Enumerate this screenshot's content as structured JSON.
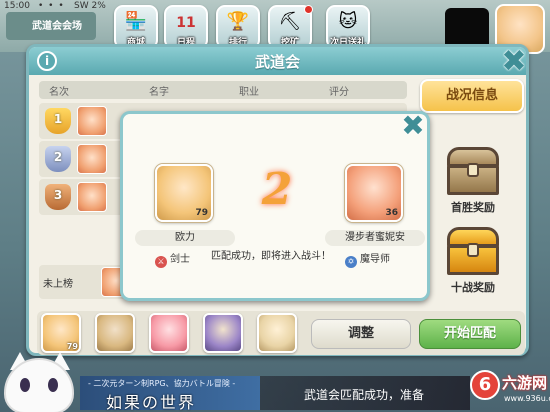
{
  "status_bar": {
    "time": "15:00",
    "dots": "• • •",
    "right": "SW 2%"
  },
  "top_banner": {
    "label": "武道会会场"
  },
  "top_icons": [
    {
      "label": "商城",
      "icon": "shop-icon",
      "glyph": "🏪"
    },
    {
      "label": "日程",
      "icon": "calendar-icon",
      "glyph": "📅",
      "value": "11"
    },
    {
      "label": "排行",
      "icon": "trophy-icon",
      "glyph": "🏆"
    },
    {
      "label": "挖矿",
      "icon": "mining-icon",
      "glyph": "⛏"
    },
    {
      "label": "次日送礼",
      "icon": "gift-icon",
      "glyph": "🐱"
    }
  ],
  "main_panel": {
    "title": "武道会",
    "columns": [
      "名次",
      "名字",
      "职业",
      "评分"
    ],
    "ranks": [
      {
        "rank": "1"
      },
      {
        "rank": "2"
      },
      {
        "rank": "3"
      }
    ],
    "unranked_label": "未上榜",
    "battle_info_label": "战况信息",
    "first_win_label": "首胜奖励",
    "ten_battle_label": "十战奖励",
    "team": [
      {
        "level": "79"
      },
      {
        "level": ""
      },
      {
        "level": ""
      },
      {
        "level": ""
      },
      {
        "level": ""
      }
    ],
    "adjust_label": "调整",
    "start_match_label": "开始匹配"
  },
  "match_popup": {
    "countdown": "2",
    "message": "匹配成功，即将进入战斗！",
    "player": {
      "name": "欧力",
      "class": "剑士",
      "level": "79"
    },
    "opponent": {
      "name": "漫步者蜜妮安",
      "class": "魔导师",
      "level": "36"
    }
  },
  "ad_overlay": {
    "subtitle": "- 二次元ターン制RPG、協力バトル冒険 -",
    "title": "如果の世界"
  },
  "toast": {
    "text": "武道会匹配成功，准备"
  },
  "watermark": {
    "logo": "6",
    "text": "六游网",
    "url": "www.936u.com"
  },
  "colors": {
    "accent": "#5aa9b0",
    "start_green": "#5eb24a",
    "gold": "#f5c24a",
    "countdown": "#f4a23a"
  }
}
